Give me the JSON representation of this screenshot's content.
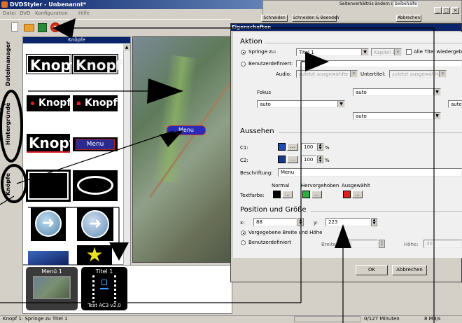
{
  "app": {
    "title": "DVDStyler - Unbenannt*",
    "menu": [
      "Datei",
      "DVD",
      "Konfiguration",
      "Hilfe"
    ]
  },
  "side_tabs": [
    "Dateimanager",
    "Hintergründe",
    "Knöpfe"
  ],
  "buttons_panel": {
    "header": "Knöpfe",
    "items": [
      "Knopf",
      "Knopf",
      "Knopf",
      "Knopf",
      "Knopf",
      "Menu"
    ]
  },
  "canvas": {
    "menu_button": "Menu"
  },
  "titlebar": {
    "label": "Menü 1",
    "title_thumb": "Titel 1",
    "thumb_caption": "Test AC3 v2.0"
  },
  "statusbar": {
    "left": "Knopf 1: Springe zu Titel 1",
    "minutes": "0/127 Minuten",
    "rate": "8 MB/s"
  },
  "top_dialog": {
    "label": "Seitenverhältnis ändern in",
    "select_value": "beibehalten",
    "btn_close": "Schneiden",
    "btn_close_finish": "Schneiden & Beenden",
    "btn_cancel": "Abbrechen"
  },
  "props": {
    "title": "Eigenschaften",
    "aktion": {
      "heading": "Aktion",
      "jump_label": "Springe zu:",
      "jump_value": "Titel 1",
      "chapter_value": "Kapitel 1",
      "all_titles": "Alle Titel wiedergeben",
      "user_defined": "Benutzerdefiniert:",
      "audio_label": "Audio:",
      "audio_value": "zuletzt ausgewählte",
      "subtitle_label": "Untertitel:",
      "subtitle_value": "zuletzt ausgewählte",
      "focus_label": "Fokus",
      "focus_up": "auto",
      "focus_left": "auto",
      "focus_right": "auto",
      "focus_down": "auto"
    },
    "aussehen": {
      "heading": "Aussehen",
      "c1_label": "C1:",
      "c1_value": "100",
      "c2_label": "C2:",
      "c2_value": "100",
      "percent": "%",
      "caption_label": "Beschriftung:",
      "caption_value": "Menu",
      "normal": "Normal",
      "highlighted": "Hervorgehoben",
      "selected": "Ausgewählt",
      "textcolor_label": "Textfarbe:",
      "browse": "...",
      "colors": {
        "c1": "#1f4fa8",
        "c2": "#1a3a90",
        "normal": "#000000",
        "highlighted": "#28b040",
        "selected": "#e02020"
      }
    },
    "position": {
      "heading": "Position und Größe",
      "x_label": "x:",
      "x_value": "88",
      "y_label": "y:",
      "y_value": "223",
      "default_size": "Vorgegebene Breite und Höhe",
      "custom_size": "Benutzerdefiniert",
      "width_label": "Breite:",
      "width_value": "100",
      "height_label": "Höhe:",
      "height_value": "30"
    },
    "ok": "OK",
    "cancel": "Abbrechen"
  }
}
